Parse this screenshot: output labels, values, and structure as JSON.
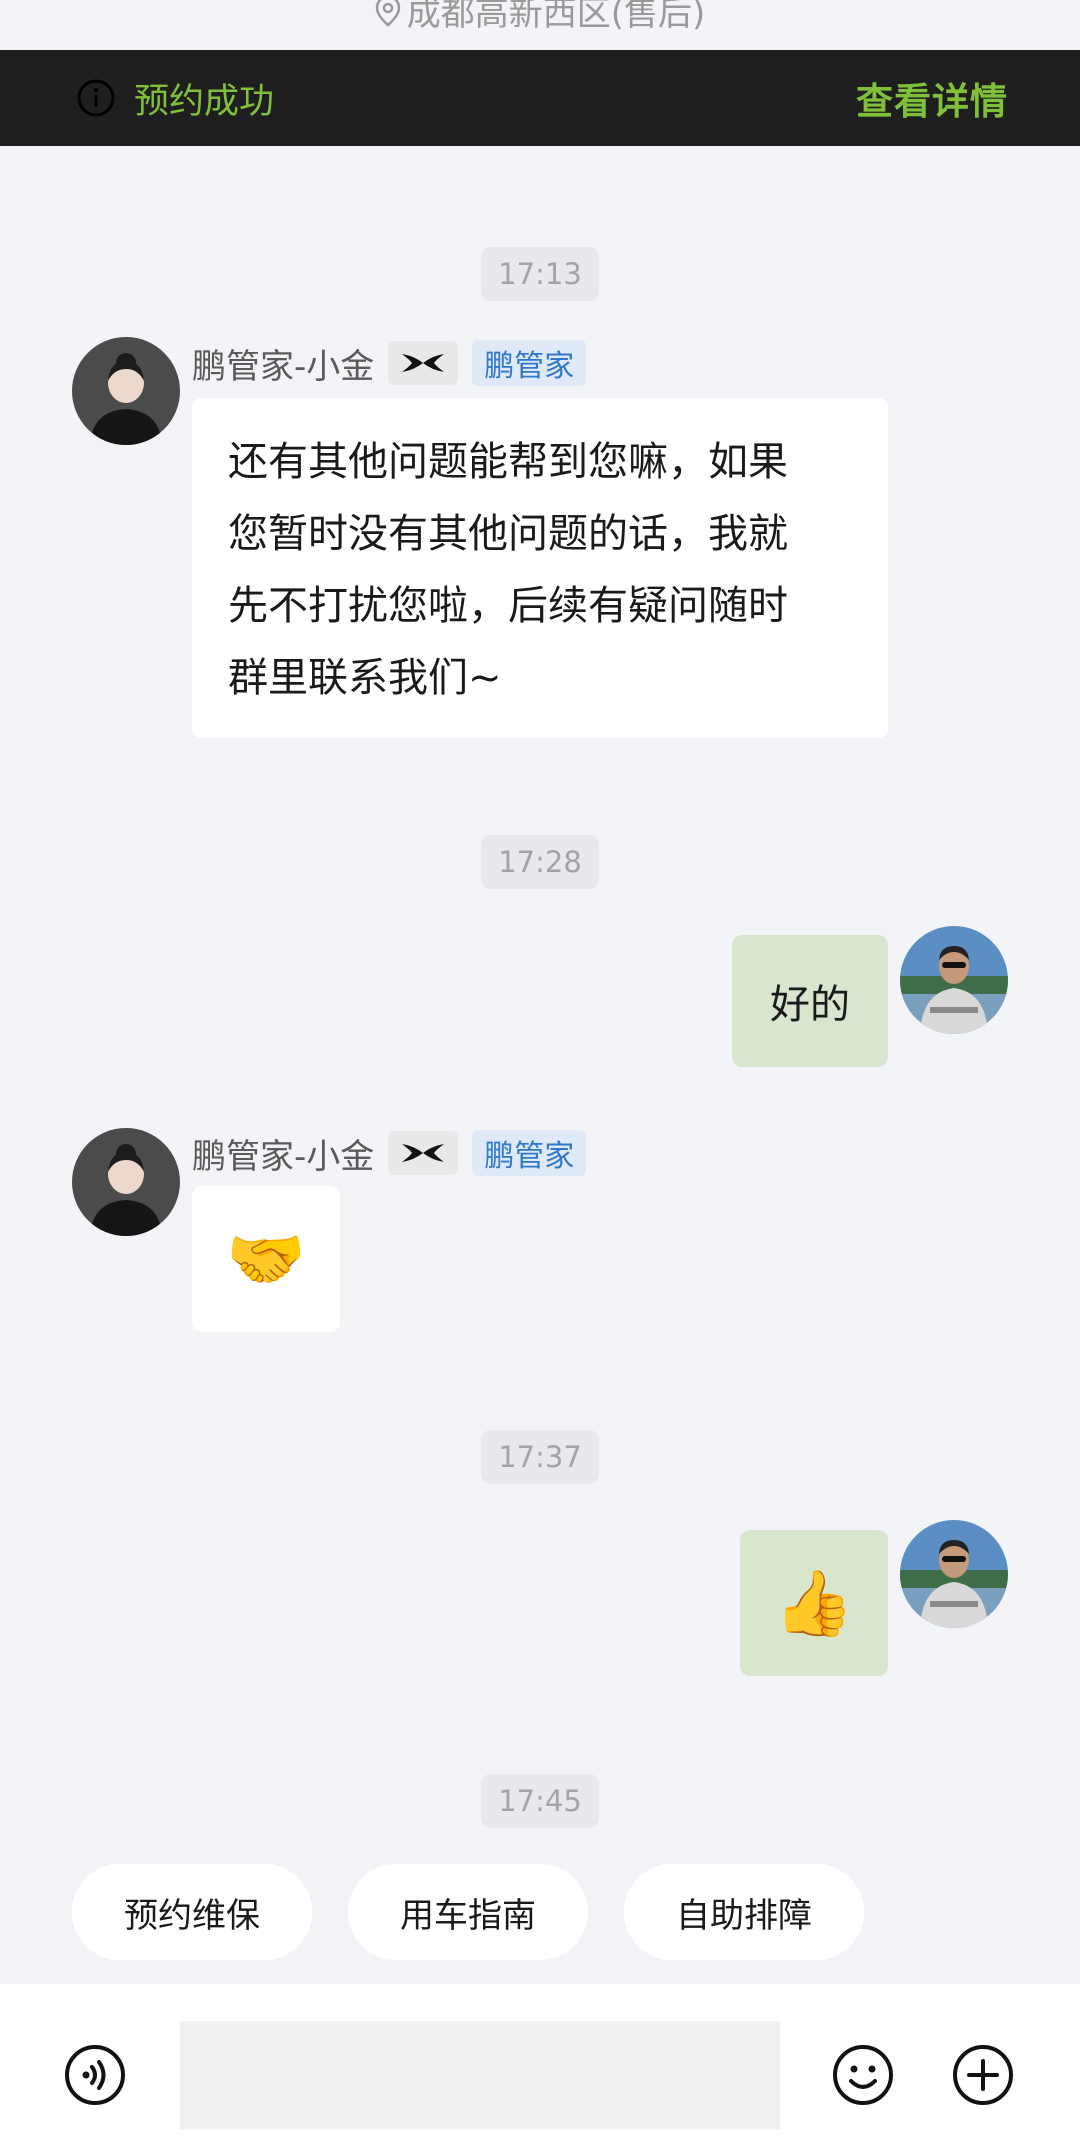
{
  "location": {
    "icon": "location-pin-icon",
    "text": "成都高新西区(售后)"
  },
  "banner": {
    "icon": "info-icon",
    "status": "预约成功",
    "link": "查看详情",
    "accent": "#7fbf3a",
    "background": "#1e1e1e"
  },
  "messages": [
    {
      "time": "17:13"
    },
    {
      "sender": "鹏管家-小金",
      "tag": "鹏管家",
      "text": "还有其他问题能帮到您嘛，如果\n您暂时没有其他问题的话，我就\n先不打扰您啦，后续有疑问随时\n群里联系我们~"
    },
    {
      "time": "17:28"
    },
    {
      "from": "me",
      "text": "好的"
    },
    {
      "sender": "鹏管家-小金",
      "tag": "鹏管家",
      "emoji": "🤝"
    },
    {
      "time": "17:37"
    },
    {
      "from": "me",
      "emoji": "👍"
    },
    {
      "time": "17:45"
    }
  ],
  "quick_replies": [
    "预约维保",
    "用车指南",
    "自助排障"
  ],
  "input": {
    "placeholder": ""
  },
  "toolbar": {
    "voice_icon": "voice-icon",
    "emoji_icon": "smiley-icon",
    "plus_icon": "plus-icon"
  },
  "colors": {
    "my_bubble": "#d7e6cd",
    "tag_text": "#2f79c7",
    "tag_bg": "#dfe9f7"
  }
}
